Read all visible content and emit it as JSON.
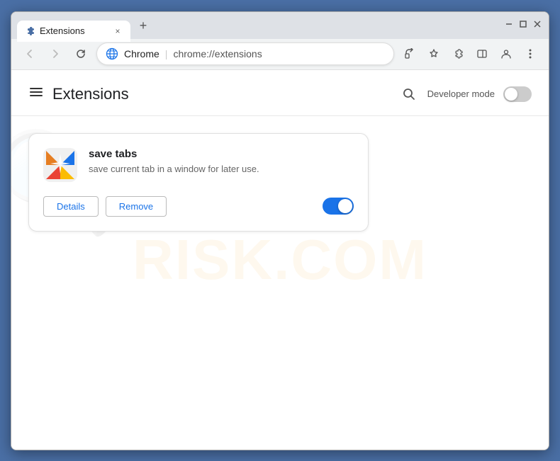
{
  "window": {
    "title": "Extensions",
    "tab_close": "×",
    "new_tab": "+",
    "win_minimize": "—",
    "win_maximize": "□",
    "win_close": "×"
  },
  "addressbar": {
    "site_name": "Chrome",
    "url": "chrome://extensions",
    "back_arrow": "←",
    "forward_arrow": "→",
    "reload": "↻",
    "divider": "|"
  },
  "extensions_page": {
    "title": "Extensions",
    "developer_mode_label": "Developer mode",
    "developer_mode_on": false
  },
  "extension": {
    "name": "save tabs",
    "description": "save current tab in a window for later use.",
    "details_label": "Details",
    "remove_label": "Remove",
    "enabled": true
  },
  "watermark": {
    "text": "RISK.COM"
  }
}
